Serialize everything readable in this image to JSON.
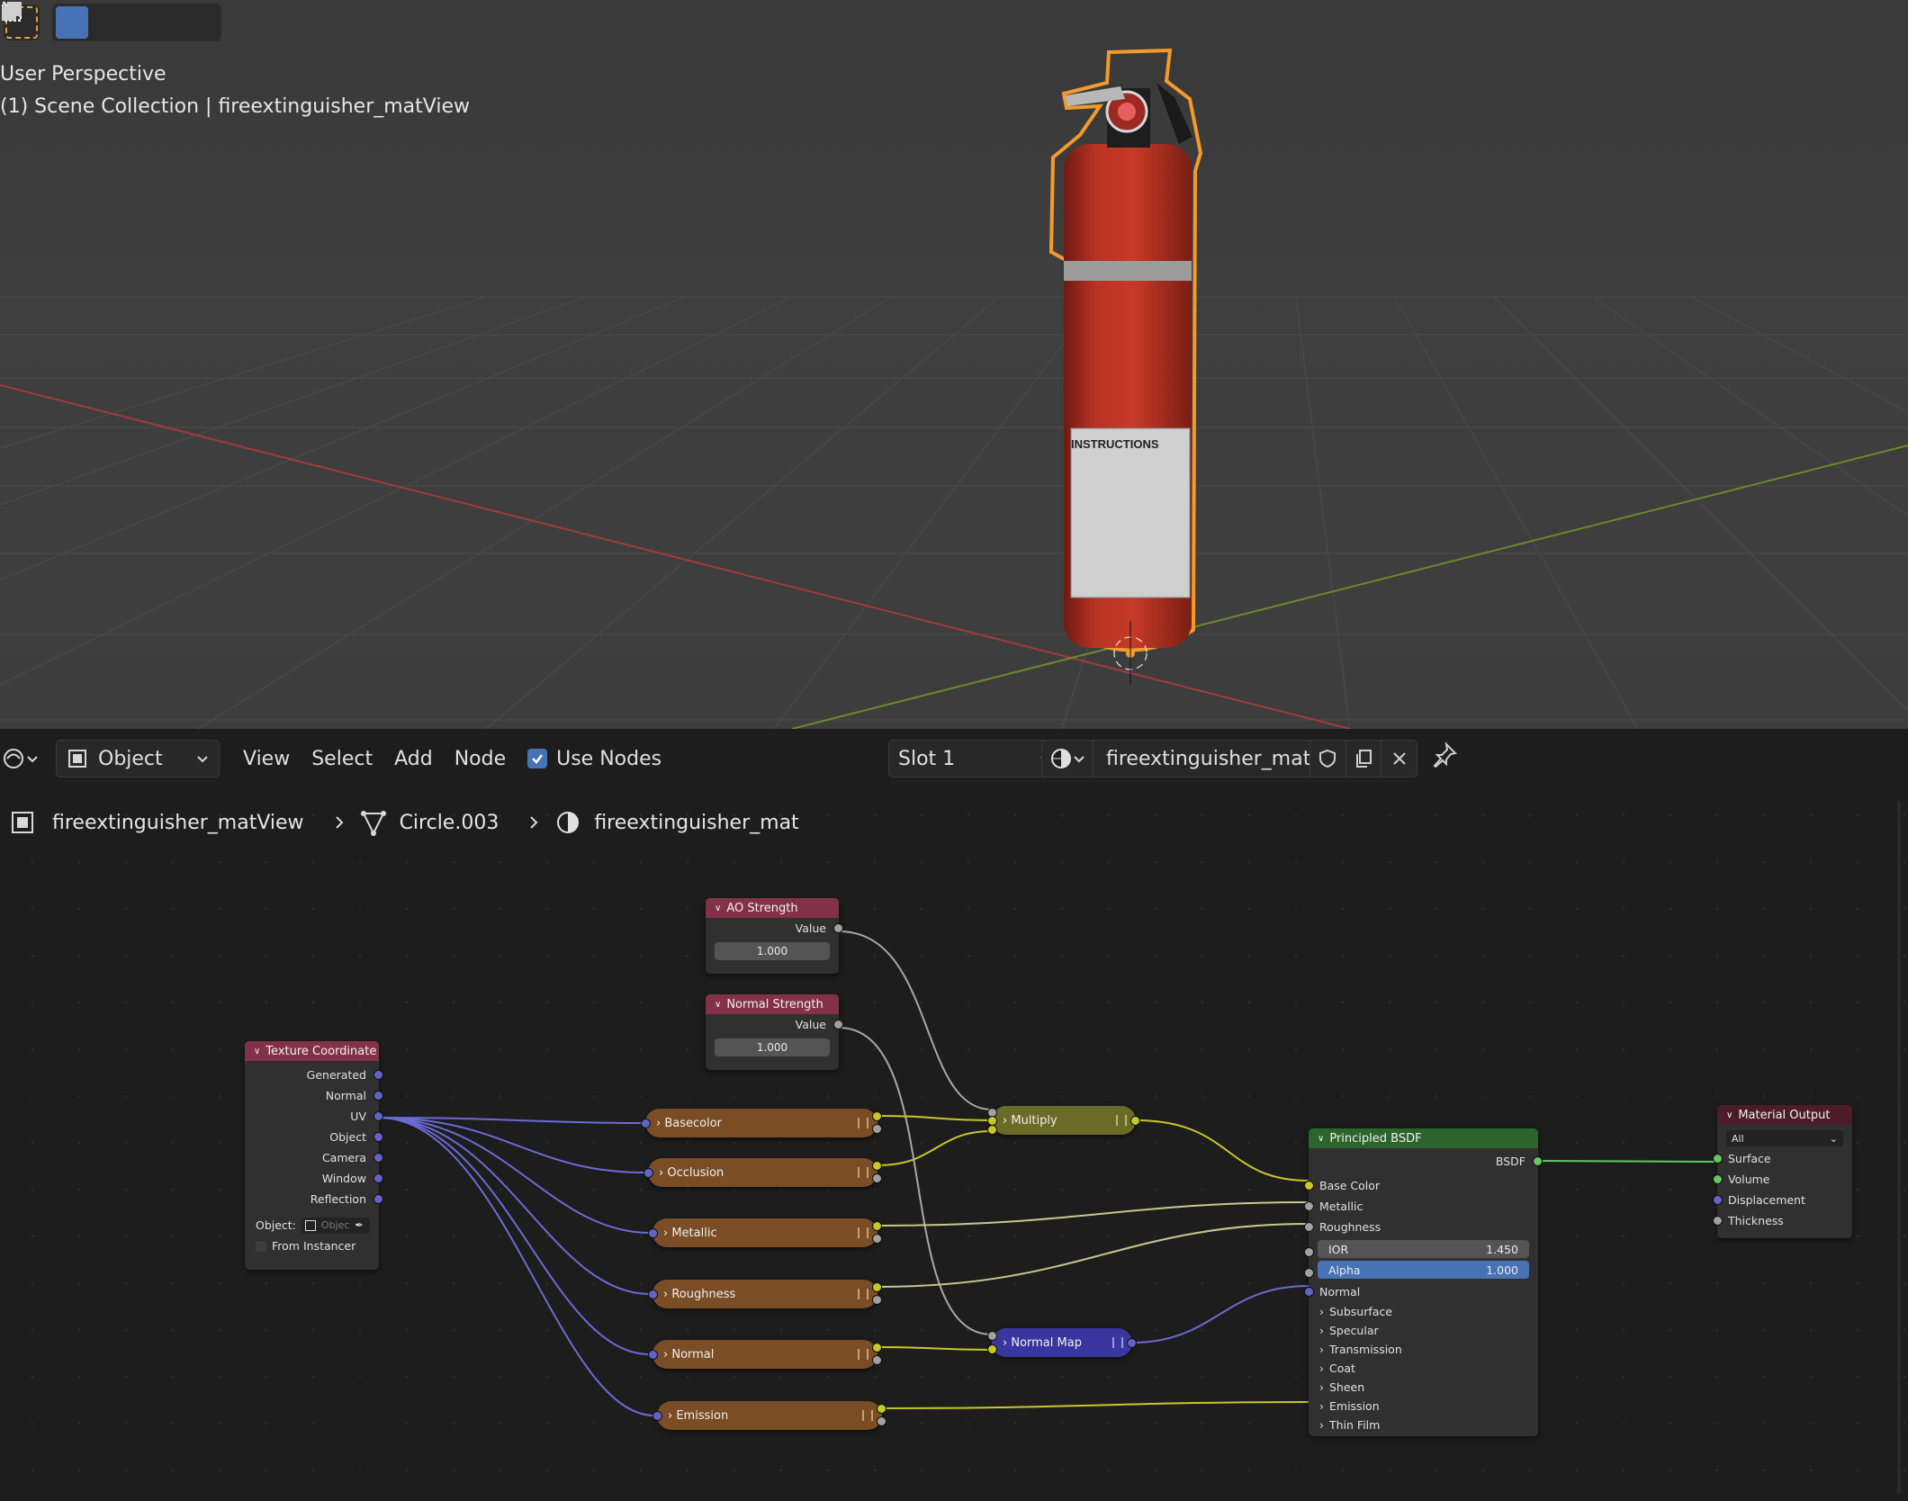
{
  "viewport": {
    "overlay_line1": "User Perspective",
    "overlay_line2": "(1) Scene Collection | fireextinguisher_matView",
    "label_top": "INSTRUCTIONS"
  },
  "header": {
    "mode": "Object",
    "menus": [
      "View",
      "Select",
      "Add",
      "Node"
    ],
    "use_nodes_label": "Use Nodes",
    "slot": "Slot 1",
    "material": "fireextinguisher_mat"
  },
  "breadcrumb": {
    "object": "fireextinguisher_matView",
    "mesh": "Circle.003",
    "material": "fireextinguisher_mat"
  },
  "nodes": {
    "ao": {
      "title": "AO Strength",
      "out": "Value",
      "value": "1.000"
    },
    "normal_strength": {
      "title": "Normal Strength",
      "out": "Value",
      "value": "1.000"
    },
    "texcoord": {
      "title": "Texture Coordinate",
      "outputs": [
        "Generated",
        "Normal",
        "UV",
        "Object",
        "Camera",
        "Window",
        "Reflection"
      ],
      "object_label": "Object:",
      "object_placeholder": "Objec",
      "from_instancer": "From Instancer"
    },
    "groups": [
      "Basecolor",
      "Occlusion",
      "Metallic",
      "Roughness",
      "Normal",
      "Emission"
    ],
    "multiply": "Multiply",
    "normal_map": "Normal Map",
    "bsdf": {
      "title": "Principled BSDF",
      "out": "BSDF",
      "inputs": [
        "Base Color",
        "Metallic",
        "Roughness"
      ],
      "ior_label": "IOR",
      "ior_value": "1.450",
      "alpha_label": "Alpha",
      "alpha_value": "1.000",
      "normal": "Normal",
      "panels": [
        "Subsurface",
        "Specular",
        "Transmission",
        "Coat",
        "Sheen",
        "Emission",
        "Thin Film"
      ]
    },
    "output": {
      "title": "Material Output",
      "target": "All",
      "inputs": [
        "Surface",
        "Volume",
        "Displacement",
        "Thickness"
      ]
    }
  },
  "colors": {
    "accent": "#4772b3",
    "input_header": "#83314a",
    "shader_header": "#2b652b",
    "output_header": "#4d1c2a",
    "group_node": "#7a4d25",
    "converter_node": "#6b6b28",
    "vector_node": "#3a36a0",
    "socket_color": "#c7c729",
    "socket_vector": "#6363c7"
  }
}
